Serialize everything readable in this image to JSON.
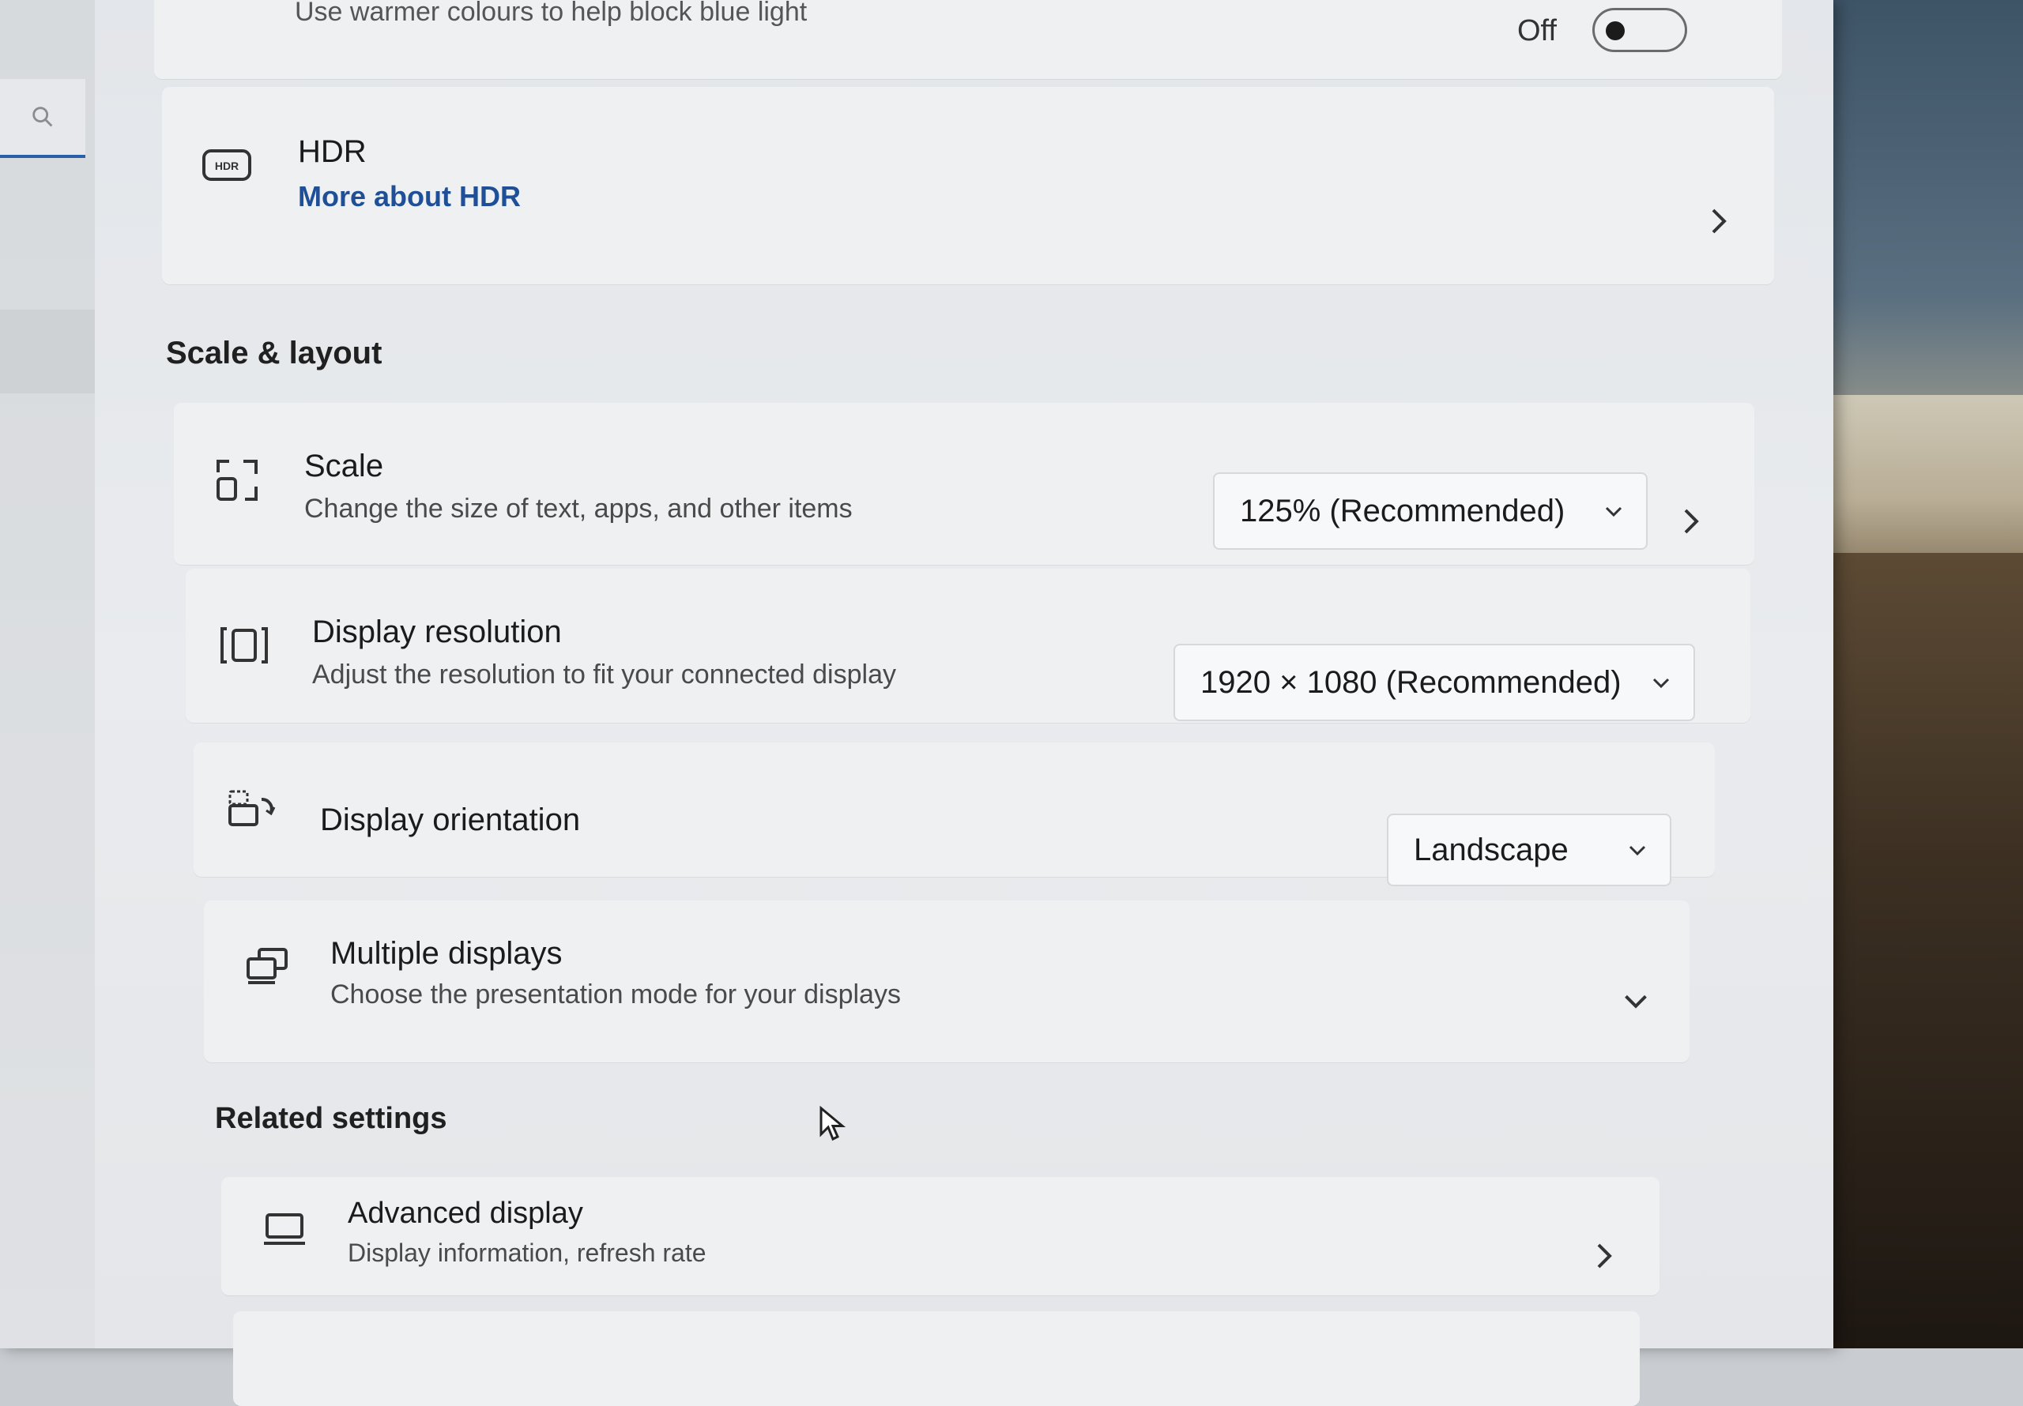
{
  "night_light": {
    "subtitle": "Use warmer colours to help block blue light",
    "state": "Off"
  },
  "hdr": {
    "title": "HDR",
    "link": "More about HDR"
  },
  "scale_layout": {
    "heading": "Scale & layout",
    "scale": {
      "title": "Scale",
      "subtitle": "Change the size of text, apps, and other items",
      "value": "125% (Recommended)"
    },
    "resolution": {
      "title": "Display resolution",
      "subtitle": "Adjust the resolution to fit your connected display",
      "value": "1920 × 1080 (Recommended)"
    },
    "orientation": {
      "title": "Display orientation",
      "value": "Landscape"
    },
    "multiple": {
      "title": "Multiple displays",
      "subtitle": "Choose the presentation mode for your displays"
    }
  },
  "related": {
    "heading": "Related settings",
    "advanced": {
      "title": "Advanced display",
      "subtitle": "Display information, refresh rate"
    }
  },
  "icons": {
    "search": "search-icon",
    "hdr": "hdr-icon",
    "scale": "scale-icon",
    "resolution": "resolution-icon",
    "orientation": "orientation-icon",
    "multiple": "multiple-displays-icon",
    "advanced": "monitor-icon"
  },
  "colors": {
    "link": "#1f4f96",
    "accent": "#2b5fa8"
  }
}
